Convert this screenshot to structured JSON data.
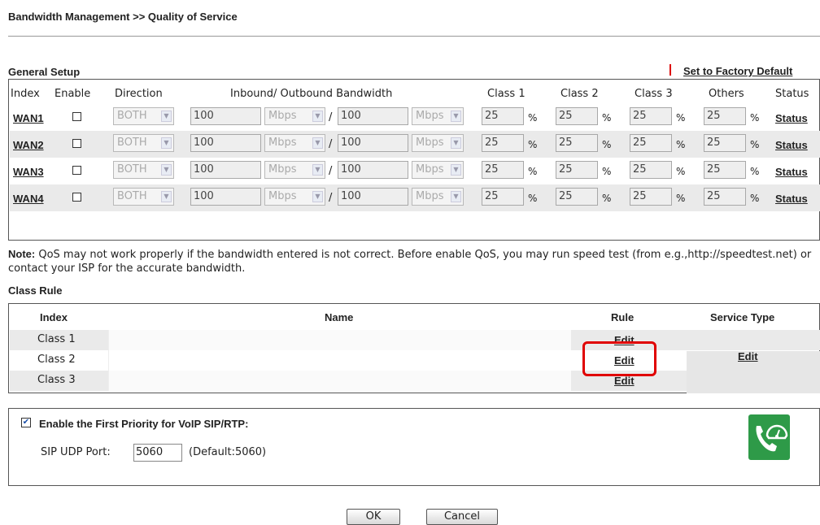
{
  "header": {
    "title": "Bandwidth Management >> Quality of Service"
  },
  "general_setup": {
    "title": "General Setup",
    "factory_link": "Set to Factory Default",
    "columns": [
      "Index",
      "Enable",
      "Direction",
      "Inbound/ Outbound Bandwidth",
      "Class 1",
      "Class 2",
      "Class 3",
      "Others",
      "Status"
    ],
    "rows": [
      {
        "index": "WAN1",
        "enabled": false,
        "direction": "BOTH",
        "inbound": "100",
        "inbound_unit": "Mbps",
        "outbound": "100",
        "outbound_unit": "Mbps",
        "class1": "25",
        "class2": "25",
        "class3": "25",
        "others": "25",
        "status": "Status"
      },
      {
        "index": "WAN2",
        "enabled": false,
        "direction": "BOTH",
        "inbound": "100",
        "inbound_unit": "Mbps",
        "outbound": "100",
        "outbound_unit": "Mbps",
        "class1": "25",
        "class2": "25",
        "class3": "25",
        "others": "25",
        "status": "Status"
      },
      {
        "index": "WAN3",
        "enabled": false,
        "direction": "BOTH",
        "inbound": "100",
        "inbound_unit": "Mbps",
        "outbound": "100",
        "outbound_unit": "Mbps",
        "class1": "25",
        "class2": "25",
        "class3": "25",
        "others": "25",
        "status": "Status"
      },
      {
        "index": "WAN4",
        "enabled": false,
        "direction": "BOTH",
        "inbound": "100",
        "inbound_unit": "Mbps",
        "outbound": "100",
        "outbound_unit": "Mbps",
        "class1": "25",
        "class2": "25",
        "class3": "25",
        "others": "25",
        "status": "Status"
      }
    ],
    "slash": "/",
    "percent": "%"
  },
  "note": {
    "label": "Note:",
    "text": " QoS may not work properly if the bandwidth entered is not correct. Before enable QoS, you may run speed test (from e.g.,http://speedtest.net) or contact your ISP for the accurate bandwidth."
  },
  "class_rule": {
    "title": "Class Rule",
    "columns": [
      "Index",
      "Name",
      "Rule",
      "Service Type"
    ],
    "rows": [
      {
        "index": "Class 1",
        "name": "",
        "rule": "Edit"
      },
      {
        "index": "Class 2",
        "name": "",
        "rule": "Edit"
      },
      {
        "index": "Class 3",
        "name": "",
        "rule": "Edit"
      }
    ],
    "service_type_edit": "Edit"
  },
  "voip": {
    "enabled": true,
    "label": "Enable the First Priority for VoIP SIP/RTP:",
    "sip_port_label": "SIP UDP Port:",
    "sip_port_value": "5060",
    "default_text": "(Default:5060)",
    "icon": "voip-phone-icon"
  },
  "buttons": {
    "ok": "OK",
    "cancel": "Cancel"
  },
  "colors": {
    "highlight": "#e00000",
    "voip_icon": "#2e9a48",
    "separator": "#dd0000"
  }
}
